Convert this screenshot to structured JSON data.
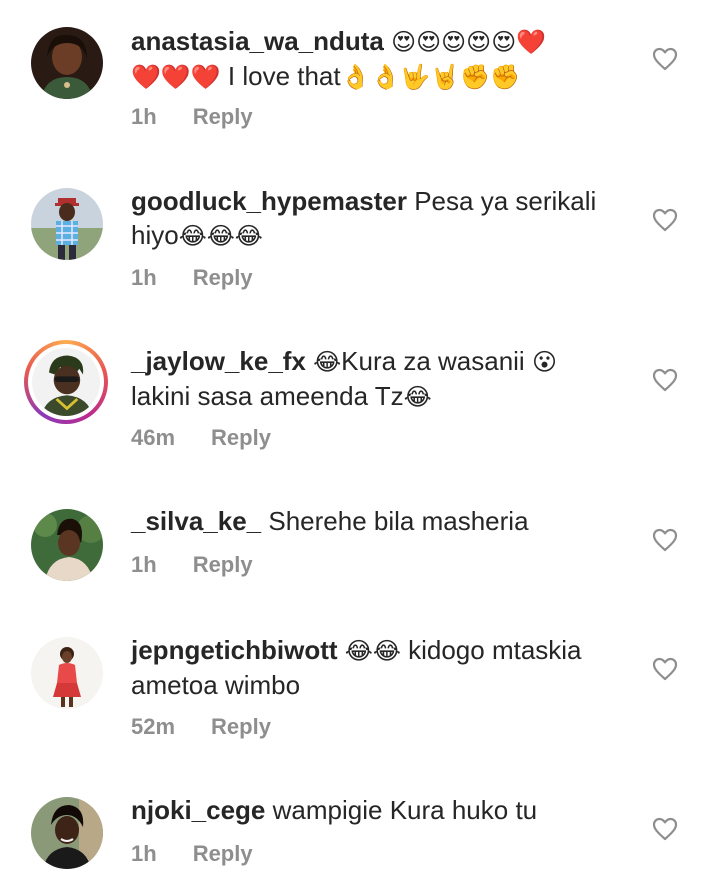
{
  "comments": [
    {
      "username": "anastasia_wa_nduta",
      "text_parts": [
        "😍😍😍😍😍❤️",
        "❤️❤️❤️",
        " I love that",
        "👌👌🤟🤘✊✊"
      ],
      "time": "1h",
      "reply_label": "Reply",
      "avatar_icon": "avatar-photo-woman"
    },
    {
      "username": "goodluck_hypemaster",
      "text": "Pesa ya serikali",
      "text2": "hiyo",
      "emoji": "😂😂😂",
      "time": "1h",
      "reply_label": "Reply",
      "avatar_icon": "avatar-photo-man-cap"
    },
    {
      "username": "_jaylow_ke_fx",
      "emoji1": "😂",
      "text": "Kura za wasanii ",
      "emoji2": "😮",
      "text2": "lakini sasa ameenda Tz",
      "emoji3": "😂",
      "time": "46m",
      "reply_label": "Reply",
      "avatar_icon": "avatar-illustration-story-ring"
    },
    {
      "username": "_silva_ke_",
      "text": "Sherehe bila masheria",
      "time": "1h",
      "reply_label": "Reply",
      "avatar_icon": "avatar-photo-woman-green"
    },
    {
      "username": "jepngetichbiwott",
      "emoji": "😂😂",
      "text": " kidogo mtaskia",
      "text2": "ametoa wimbo",
      "time": "52m",
      "reply_label": "Reply",
      "avatar_icon": "avatar-photo-woman-red"
    },
    {
      "username": "njoki_cege",
      "text": "wampigie Kura huko tu",
      "time": "1h",
      "reply_label": "Reply",
      "avatar_icon": "avatar-photo-woman-dark"
    }
  ],
  "like_icon": "heart-outline-icon",
  "colors": {
    "text": "#262626",
    "meta": "#8e8e8e",
    "background": "#ffffff"
  }
}
